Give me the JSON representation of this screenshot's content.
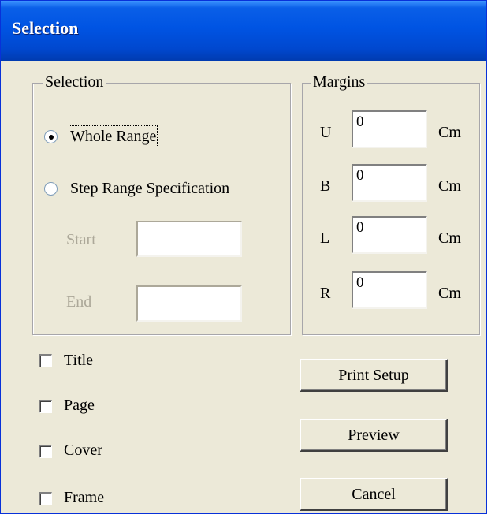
{
  "window": {
    "title": "Selection"
  },
  "selection_group": {
    "legend": "Selection",
    "options": [
      {
        "label": "Whole Range",
        "selected": true
      },
      {
        "label": "Step Range Specification",
        "selected": false
      }
    ],
    "start_label": "Start",
    "start_value": "",
    "end_label": "End",
    "end_value": ""
  },
  "margins_group": {
    "legend": "Margins",
    "unit": "Cm",
    "fields": [
      {
        "label": "U",
        "value": "0"
      },
      {
        "label": "B",
        "value": "0"
      },
      {
        "label": "L",
        "value": "0"
      },
      {
        "label": "R",
        "value": "0"
      }
    ]
  },
  "checkboxes": [
    {
      "label": "Title",
      "checked": false
    },
    {
      "label": "Page",
      "checked": false
    },
    {
      "label": "Cover",
      "checked": false
    },
    {
      "label": "Frame",
      "checked": false
    }
  ],
  "buttons": {
    "print_setup": "Print Setup",
    "preview": "Preview",
    "cancel": "Cancel"
  }
}
